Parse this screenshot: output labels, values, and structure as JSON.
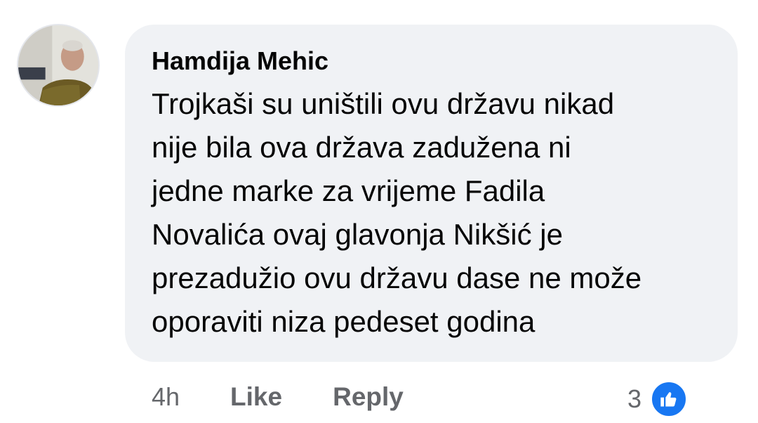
{
  "comment": {
    "author": "Hamdija Mehic",
    "text_lines": [
      "Trojkaši su uništili ovu državu nikad",
      "nije bila ova država zadužena ni",
      "jedne marke za vrijeme Fadila",
      "Novalića ovaj glavonja Nikšić je",
      "prezadužio ovu državu dase ne može",
      "oporaviti niza pedeset godina"
    ],
    "timestamp": "4h",
    "like_label": "Like",
    "reply_label": "Reply",
    "reaction_count": "3",
    "reaction_icon": "thumbs-up-icon",
    "reaction_color": "#1877f2",
    "bubble_color": "#f0f2f5"
  }
}
